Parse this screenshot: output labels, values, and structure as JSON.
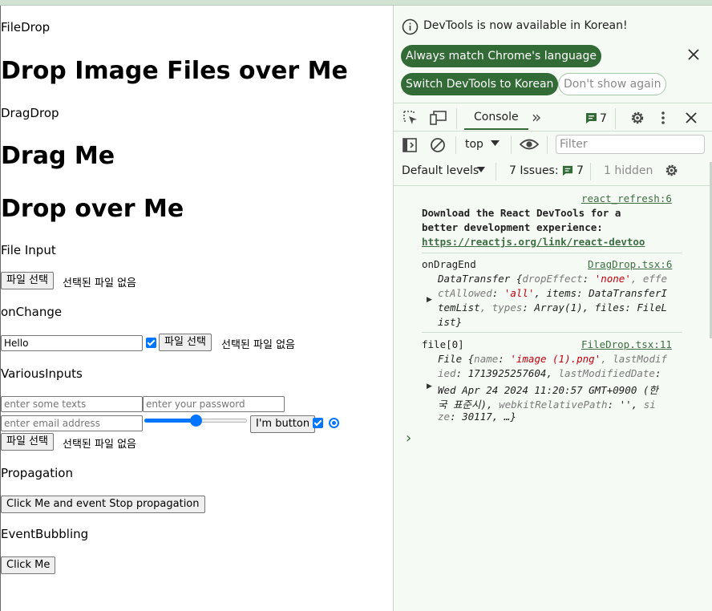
{
  "page": {
    "filedrop_label": "FileDrop",
    "filedrop_heading": "Drop Image Files over Me",
    "dragdrop_label": "DragDrop",
    "drag_heading": "Drag Me",
    "drop_heading": "Drop over Me",
    "file_input_label": "File Input",
    "choose_file_label": "파일 선택",
    "no_file_text": "선택된 파일 없음",
    "onchange_label": "onChange",
    "hello_value": "Hello",
    "various_label": "VariousInputs",
    "text_placeholder": "enter some texts",
    "password_placeholder": "enter your password",
    "email_placeholder": "enter email address",
    "range_value": 0.5,
    "im_button_label": "I'm button",
    "propagation_label": "Propagation",
    "propagation_button": "Click Me and event Stop propagation",
    "bubbling_label": "EventBubbling",
    "click_me_button": "Click Me"
  },
  "devtools": {
    "banner_text": "DevTools is now available in Korean!",
    "always_match": "Always match Chrome's language",
    "switch_korean": "Switch DevTools to Korean",
    "dont_show": "Don't show again",
    "tab_console": "Console",
    "more_tabs": "»",
    "message_count": "7",
    "context": "top",
    "filter_placeholder": "Filter",
    "default_levels": "Default levels",
    "issues_label": "7 Issues:",
    "issues_count": "7",
    "hidden": "1 hidden",
    "prompt": "›",
    "colors": {
      "accent": "#326b36",
      "background": "#f5faf4",
      "string": "#c4000e"
    }
  },
  "console": [
    {
      "source": "react_refresh:6",
      "lines": [
        "Download the React DevTools for a",
        "better development experience:"
      ],
      "link": "https://reactjs.org/link/react-devtoo"
    },
    {
      "label": "onDragEnd",
      "source": "DragDrop.tsx:6",
      "obj_type": "DataTransfer",
      "dropEffect_key": "dropEffect",
      "dropEffect_val": "'none'",
      "tail1": ", effe",
      "effectAllowed_key": "ctAllowed",
      "effectAllowed_val": "'all'",
      "items": ", items: DataTransferI",
      "tempList": "temList",
      "types_key": ", types",
      "types_val": ": Array(1), ",
      "files": "files: FileL",
      "end": "ist}"
    },
    {
      "label": "file[0]",
      "source": "FileDrop.tsx:11",
      "obj_type": "File",
      "name_key": "name",
      "name_val": "'image (1).png'",
      "lastmod_key": ", lastModif",
      "ied": "ied",
      "lastmod_val": ": 1713925257604, ",
      "lastmoddate_key": "lastModifiedDate",
      "date_val": "Wed Apr 24 2024 11:20:57 GMT+0900 (한",
      "korean_tz": "국 표준시), ",
      "webkit_key": "webkitRelativePath",
      "webkit_val": ": '', ",
      "si": "si",
      "ze": "ze",
      "size_val": ": 30117, …}"
    }
  ]
}
